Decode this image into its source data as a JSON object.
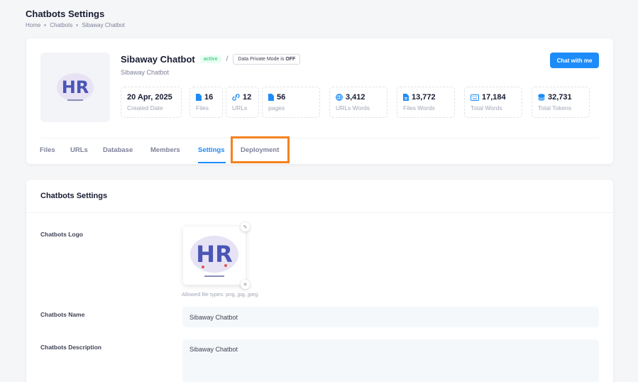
{
  "header": {
    "title": "Chatbots Settings",
    "breadcrumb": [
      "Home",
      "Chatbots",
      "Sibaway Chatbot"
    ]
  },
  "bot": {
    "name": "Sibaway Chatbot",
    "status": "active",
    "slash": "/",
    "private_mode_label": "Data Private Mode is",
    "private_mode_value": "OFF",
    "subtitle": "Sibaway Chatbot",
    "chat_button": "Chat with me"
  },
  "stats": [
    {
      "value": "20 Apr, 2025",
      "label": "Created Date",
      "icon": "none"
    },
    {
      "value": "16",
      "label": "Files",
      "icon": "file-icon"
    },
    {
      "value": "12",
      "label": "URLs",
      "icon": "link-icon"
    },
    {
      "value": "56",
      "label": "pages",
      "icon": "file-icon"
    },
    {
      "value": "3,412",
      "label": "URLs Words",
      "icon": "globe-icon"
    },
    {
      "value": "13,772",
      "label": "Files Words",
      "icon": "word-file-icon"
    },
    {
      "value": "17,184",
      "label": "Total Words",
      "icon": "keyboard-icon"
    },
    {
      "value": "32,731",
      "label": "Total Tokens",
      "icon": "database-icon"
    }
  ],
  "tabs": [
    "Files",
    "URLs",
    "Database",
    "Members",
    "Settings",
    "Deployment"
  ],
  "active_tab": "Settings",
  "settings": {
    "title": "Chatbots Settings",
    "logo_label": "Chatbots Logo",
    "logo_hint": "Allowed file types: png, jpg, jpeg.",
    "name_label": "Chatbots Name",
    "name_value": "Sibaway Chatbot",
    "description_label": "Chatbots Description",
    "description_value": "Sibaway Chatbot"
  },
  "colors": {
    "primary": "#1d8cf8",
    "active_badge": "#50cd89",
    "highlight": "#f5821f",
    "hr_logo": "#4a55b5"
  }
}
